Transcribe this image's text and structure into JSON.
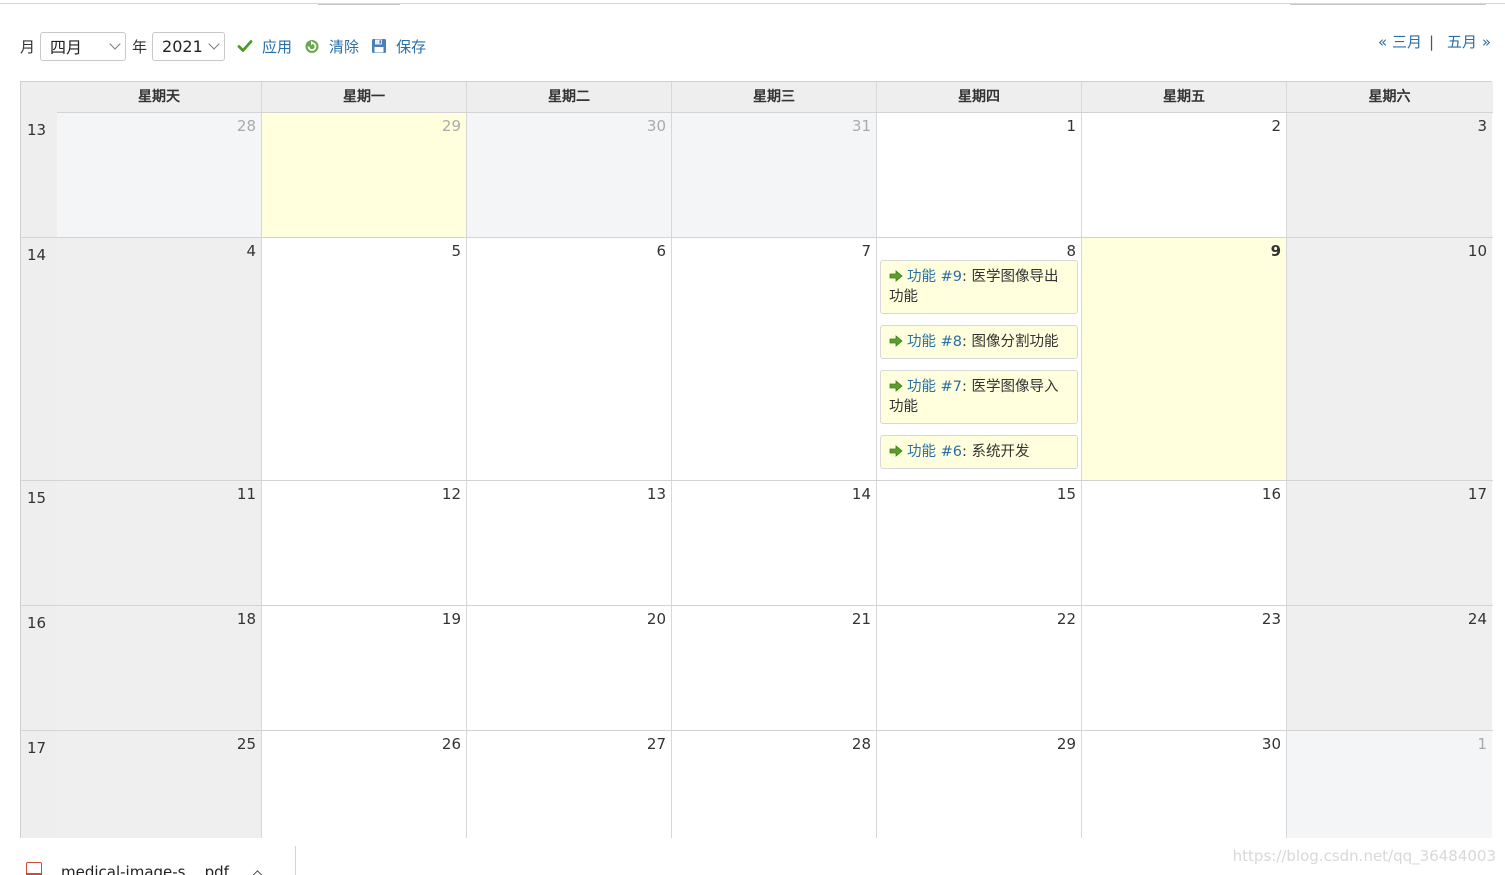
{
  "toolbar": {
    "month_label": "月",
    "month_value": "四月",
    "year_label": "年",
    "year_value": "2021",
    "apply": "应用",
    "clear": "清除",
    "save": "保存"
  },
  "nav": {
    "prev": "« 三月",
    "separator": "|",
    "next": "五月 »"
  },
  "weekdays": [
    "星期天",
    "星期一",
    "星期二",
    "星期三",
    "星期四",
    "星期五",
    "星期六"
  ],
  "weeks": [
    {
      "number": "13",
      "days": [
        "28",
        "29",
        "30",
        "31",
        "1",
        "2",
        "3"
      ]
    },
    {
      "number": "14",
      "days": [
        "4",
        "5",
        "6",
        "7",
        "8",
        "9",
        "10"
      ]
    },
    {
      "number": "15",
      "days": [
        "11",
        "12",
        "13",
        "14",
        "15",
        "16",
        "17"
      ]
    },
    {
      "number": "16",
      "days": [
        "18",
        "19",
        "20",
        "21",
        "22",
        "23",
        "24"
      ]
    },
    {
      "number": "17",
      "days": [
        "25",
        "26",
        "27",
        "28",
        "29",
        "30",
        "1"
      ]
    }
  ],
  "issues": [
    {
      "link": "功能 #9",
      "subject": ": 医学图像导出功能"
    },
    {
      "link": "功能 #8",
      "subject": ": 图像分割功能"
    },
    {
      "link": "功能 #7",
      "subject": ": 医学图像导入功能"
    },
    {
      "link": "功能 #6",
      "subject": ": 系统开发"
    }
  ],
  "download": {
    "filename": "medical-image-s....pdf"
  },
  "watermark": "https://blog.csdn.net/qq_36484003",
  "colors": {
    "link": "#2a6fa8",
    "today_bg": "#ffffdd",
    "weekend_bg": "#efefef",
    "other_month_bg": "#f4f5f7"
  }
}
